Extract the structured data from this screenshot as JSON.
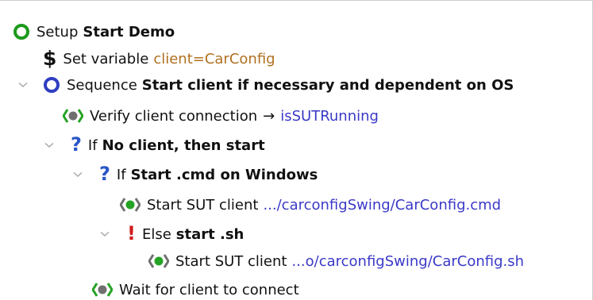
{
  "tree": {
    "nodes": [
      {
        "kind": "setup",
        "icon": "green-ring-icon",
        "label": "Setup",
        "name": "Start Demo"
      },
      {
        "kind": "set-variable",
        "icon": "dollar-icon",
        "icon_text": "$",
        "label": "Set variable",
        "value": "client=CarConfig"
      },
      {
        "kind": "sequence",
        "icon": "blue-ring-icon",
        "label": "Sequence",
        "name": "Start client if necessary and dependent on OS",
        "expanded": true
      },
      {
        "kind": "procedure-call",
        "icon": "procedure-call-icon",
        "label": "Verify client connection",
        "arrow": "→",
        "target": "isSUTRunning"
      },
      {
        "kind": "if",
        "icon": "question-icon",
        "icon_text": "?",
        "label": "If",
        "name": "No client, then start",
        "expanded": true
      },
      {
        "kind": "if",
        "icon": "question-icon",
        "icon_text": "?",
        "label": "If",
        "name": "Start .cmd on Windows",
        "expanded": true
      },
      {
        "kind": "start-client",
        "icon": "start-client-icon",
        "label": "Start SUT client",
        "path": ".../carconfigSwing/CarConfig.cmd"
      },
      {
        "kind": "else",
        "icon": "exclamation-icon",
        "icon_text": "!",
        "label": "Else",
        "name": "start .sh",
        "expanded": true
      },
      {
        "kind": "start-client",
        "icon": "start-client-icon",
        "label": "Start SUT client",
        "path": "...o/carconfigSwing/CarConfig.sh"
      },
      {
        "kind": "wait",
        "icon": "wait-client-icon",
        "label": "Wait for client to connect"
      }
    ]
  },
  "colors": {
    "setup_ring": "#1c9a1c",
    "sequence_ring": "#2f3ec0",
    "question_mark": "#2a56c6",
    "exclamation": "#d01c1c",
    "variable_value": "#b0701f",
    "link_text": "#3a39c8",
    "procedure_green": "#24a324",
    "procedure_grey": "#707070"
  }
}
